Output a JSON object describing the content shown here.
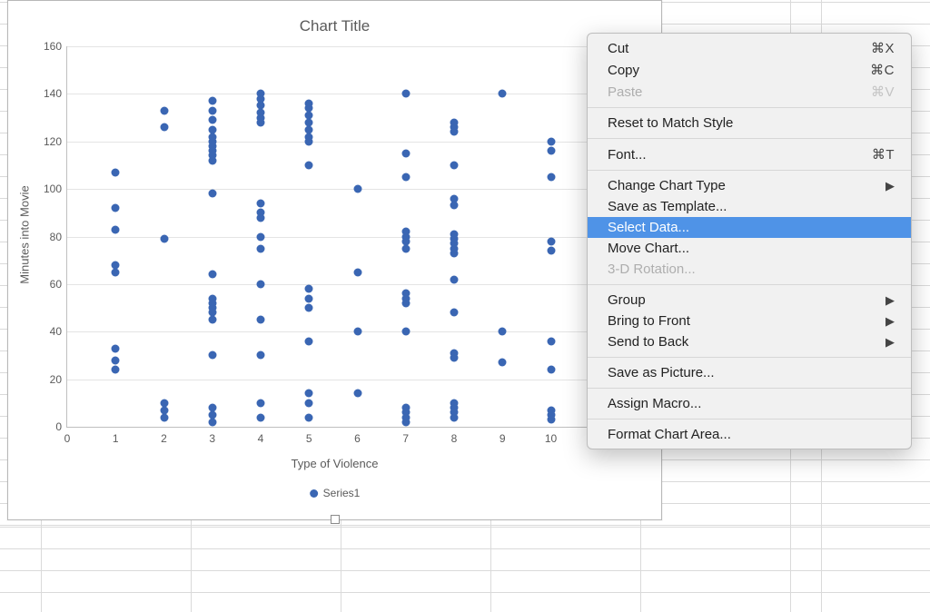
{
  "chart_data": {
    "type": "scatter",
    "title": "Chart Title",
    "xlabel": "Type of Violence",
    "ylabel": "Minutes into Movie",
    "xlim": [
      0,
      12
    ],
    "ylim": [
      0,
      160
    ],
    "xticks": [
      0,
      1,
      2,
      3,
      4,
      5,
      6,
      7,
      8,
      9,
      10
    ],
    "yticks": [
      0,
      20,
      40,
      60,
      80,
      100,
      120,
      140,
      160
    ],
    "series": [
      {
        "name": "Series1",
        "color": "#3a66b3",
        "points": [
          [
            1,
            24
          ],
          [
            1,
            28
          ],
          [
            1,
            33
          ],
          [
            1,
            65
          ],
          [
            1,
            68
          ],
          [
            1,
            83
          ],
          [
            1,
            92
          ],
          [
            1,
            107
          ],
          [
            2,
            4
          ],
          [
            2,
            7
          ],
          [
            2,
            10
          ],
          [
            2,
            79
          ],
          [
            2,
            126
          ],
          [
            2,
            133
          ],
          [
            3,
            2
          ],
          [
            3,
            5
          ],
          [
            3,
            8
          ],
          [
            3,
            30
          ],
          [
            3,
            45
          ],
          [
            3,
            48
          ],
          [
            3,
            50
          ],
          [
            3,
            52
          ],
          [
            3,
            54
          ],
          [
            3,
            64
          ],
          [
            3,
            98
          ],
          [
            3,
            112
          ],
          [
            3,
            114
          ],
          [
            3,
            116
          ],
          [
            3,
            118
          ],
          [
            3,
            120
          ],
          [
            3,
            122
          ],
          [
            3,
            125
          ],
          [
            3,
            129
          ],
          [
            3,
            133
          ],
          [
            3,
            137
          ],
          [
            4,
            4
          ],
          [
            4,
            10
          ],
          [
            4,
            30
          ],
          [
            4,
            45
          ],
          [
            4,
            60
          ],
          [
            4,
            75
          ],
          [
            4,
            80
          ],
          [
            4,
            88
          ],
          [
            4,
            90
          ],
          [
            4,
            94
          ],
          [
            4,
            128
          ],
          [
            4,
            130
          ],
          [
            4,
            132
          ],
          [
            4,
            135
          ],
          [
            4,
            138
          ],
          [
            4,
            140
          ],
          [
            5,
            4
          ],
          [
            5,
            10
          ],
          [
            5,
            14
          ],
          [
            5,
            36
          ],
          [
            5,
            50
          ],
          [
            5,
            54
          ],
          [
            5,
            58
          ],
          [
            5,
            110
          ],
          [
            5,
            120
          ],
          [
            5,
            122
          ],
          [
            5,
            125
          ],
          [
            5,
            128
          ],
          [
            5,
            131
          ],
          [
            5,
            134
          ],
          [
            5,
            136
          ],
          [
            6,
            14
          ],
          [
            6,
            40
          ],
          [
            6,
            65
          ],
          [
            6,
            100
          ],
          [
            7,
            2
          ],
          [
            7,
            4
          ],
          [
            7,
            6
          ],
          [
            7,
            8
          ],
          [
            7,
            40
          ],
          [
            7,
            52
          ],
          [
            7,
            54
          ],
          [
            7,
            56
          ],
          [
            7,
            75
          ],
          [
            7,
            78
          ],
          [
            7,
            80
          ],
          [
            7,
            82
          ],
          [
            7,
            105
          ],
          [
            7,
            115
          ],
          [
            7,
            140
          ],
          [
            8,
            4
          ],
          [
            8,
            6
          ],
          [
            8,
            8
          ],
          [
            8,
            10
          ],
          [
            8,
            29
          ],
          [
            8,
            31
          ],
          [
            8,
            48
          ],
          [
            8,
            62
          ],
          [
            8,
            73
          ],
          [
            8,
            75
          ],
          [
            8,
            77
          ],
          [
            8,
            79
          ],
          [
            8,
            81
          ],
          [
            8,
            93
          ],
          [
            8,
            96
          ],
          [
            8,
            110
          ],
          [
            8,
            124
          ],
          [
            8,
            126
          ],
          [
            8,
            128
          ],
          [
            9,
            27
          ],
          [
            9,
            40
          ],
          [
            9,
            140
          ],
          [
            10,
            3
          ],
          [
            10,
            5
          ],
          [
            10,
            7
          ],
          [
            10,
            24
          ],
          [
            10,
            36
          ],
          [
            10,
            74
          ],
          [
            10,
            78
          ],
          [
            10,
            105
          ],
          [
            10,
            116
          ],
          [
            10,
            120
          ]
        ]
      }
    ]
  },
  "context_menu": {
    "items": [
      {
        "label": "Cut",
        "shortcut": "⌘X",
        "enabled": true
      },
      {
        "label": "Copy",
        "shortcut": "⌘C",
        "enabled": true
      },
      {
        "label": "Paste",
        "shortcut": "⌘V",
        "enabled": false
      },
      {
        "sep": true
      },
      {
        "label": "Reset to Match Style",
        "enabled": true
      },
      {
        "sep": true
      },
      {
        "label": "Font...",
        "shortcut": "⌘T",
        "enabled": true
      },
      {
        "sep": true
      },
      {
        "label": "Change Chart Type",
        "submenu": true,
        "enabled": true
      },
      {
        "label": "Save as Template...",
        "enabled": true
      },
      {
        "label": "Select Data...",
        "enabled": true,
        "highlight": true
      },
      {
        "label": "Move Chart...",
        "enabled": true
      },
      {
        "label": "3-D Rotation...",
        "enabled": false
      },
      {
        "sep": true
      },
      {
        "label": "Group",
        "submenu": true,
        "enabled": true
      },
      {
        "label": "Bring to Front",
        "submenu": true,
        "enabled": true
      },
      {
        "label": "Send to Back",
        "submenu": true,
        "enabled": true
      },
      {
        "sep": true
      },
      {
        "label": "Save as Picture...",
        "enabled": true
      },
      {
        "sep": true
      },
      {
        "label": "Assign Macro...",
        "enabled": true
      },
      {
        "sep": true
      },
      {
        "label": "Format Chart Area...",
        "enabled": true
      }
    ]
  }
}
